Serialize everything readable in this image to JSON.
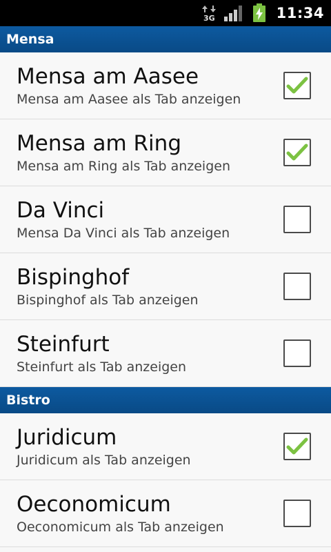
{
  "status_bar": {
    "network_label": "3G",
    "time": "11:34"
  },
  "sections": [
    {
      "header": "Mensa",
      "items": [
        {
          "title": "Mensa am Aasee",
          "summary": "Mensa am Aasee als Tab anzeigen",
          "checked": true
        },
        {
          "title": "Mensa am Ring",
          "summary": "Mensa am Ring als Tab anzeigen",
          "checked": true
        },
        {
          "title": "Da Vinci",
          "summary": "Mensa Da Vinci als Tab anzeigen",
          "checked": false
        },
        {
          "title": "Bispinghof",
          "summary": "Bispinghof als Tab anzeigen",
          "checked": false
        },
        {
          "title": "Steinfurt",
          "summary": "Steinfurt als Tab anzeigen",
          "checked": false
        }
      ]
    },
    {
      "header": "Bistro",
      "items": [
        {
          "title": "Juridicum",
          "summary": "Juridicum als Tab anzeigen",
          "checked": true
        },
        {
          "title": "Oeconomicum",
          "summary": "Oeconomicum als Tab anzeigen",
          "checked": false
        }
      ]
    }
  ],
  "colors": {
    "header_bg": "#0b5394",
    "check_green": "#7cc242"
  }
}
